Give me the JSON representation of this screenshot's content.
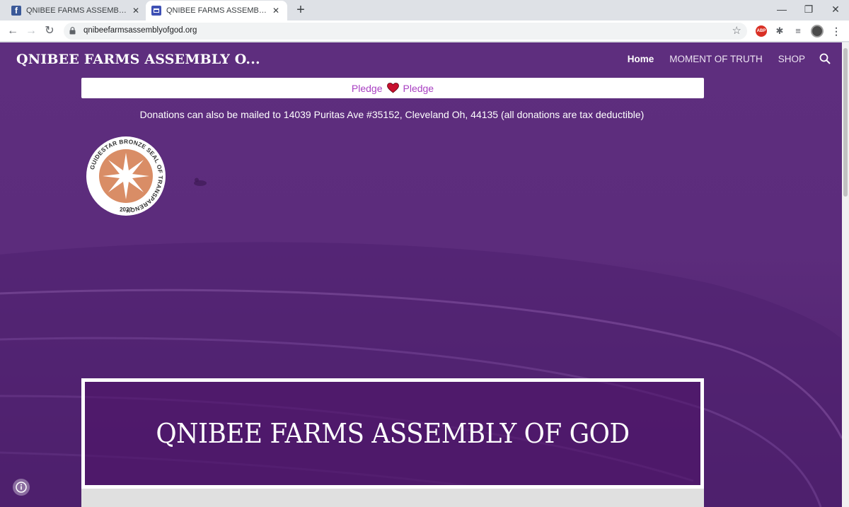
{
  "browser": {
    "tabs": [
      {
        "title": "QNIBEE FARMS ASSEMBLY OF GOD",
        "close": "✕",
        "favicon": "facebook-icon"
      },
      {
        "title": "QNIBEE FARMS ASSEMBLY OF GOD",
        "close": "✕",
        "favicon": "page-icon"
      }
    ],
    "new_tab": "+",
    "window_controls": {
      "minimize": "—",
      "maximize": "❐",
      "close": "✕"
    },
    "nav": {
      "back": "←",
      "forward": "→",
      "reload": "↻"
    },
    "url": "qnibeefarmsassemblyofgod.org",
    "bookmark": "☆",
    "extensions": {
      "abp": "ABP",
      "puzzle": "✱",
      "queue": "≡",
      "menu": "⋮"
    }
  },
  "site": {
    "title": "QNIBEE FARMS ASSEMBLY O...",
    "nav": [
      {
        "label": "Home"
      },
      {
        "label": "MOMENT OF TRUTH"
      },
      {
        "label": "SHOP"
      }
    ],
    "pledge": {
      "left": "Pledge",
      "right": "Pledge"
    },
    "donation_note": "Donations can also be mailed to 14039 Puritas Ave #35152, Cleveland Oh, 44135 (all donations are tax deductible)",
    "seal": {
      "text": "GUIDESTAR BRONZE SEAL OF TRANSPARENCY",
      "year": "2020",
      "color": "#d98d66"
    },
    "hero_title": "QNIBEE FARMS ASSEMBLY OF GOD",
    "colors": {
      "background": "#5e2e7e",
      "accent": "#a83fc2",
      "heart": "#c8102e"
    }
  }
}
